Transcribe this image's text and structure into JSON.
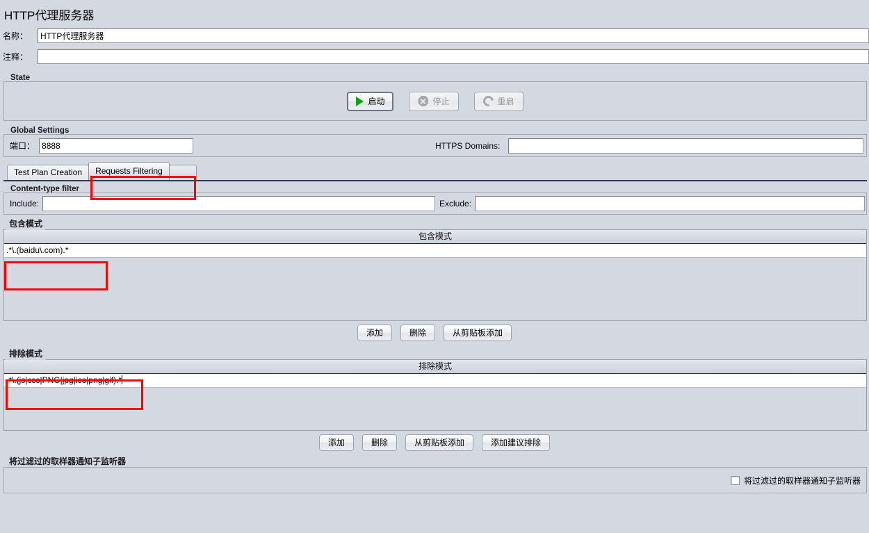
{
  "window": {
    "title": "HTTP代理服务器"
  },
  "header": {
    "name_label": "名称：",
    "name_value": "HTTP代理服务器",
    "comment_label": "注释：",
    "comment_value": ""
  },
  "state": {
    "group_title": "State",
    "buttons": [
      {
        "label": "启动",
        "icon": "play-icon",
        "enabled": true
      },
      {
        "label": "停止",
        "icon": "stop-icon",
        "enabled": false
      },
      {
        "label": "重启",
        "icon": "restart-icon",
        "enabled": false
      }
    ]
  },
  "global_settings": {
    "group_title": "Global Settings",
    "port_label": "端口：",
    "port_value": "8888",
    "https_domains_label": "HTTPS Domains:",
    "https_domains_value": ""
  },
  "tabs": [
    {
      "label": "Test Plan Creation",
      "active": false
    },
    {
      "label": "Requests Filtering",
      "active": true
    }
  ],
  "content_type_filter": {
    "group_title": "Content-type filter",
    "include_label": "Include:",
    "include_value": "",
    "exclude_label": "Exclude:",
    "exclude_value": ""
  },
  "include_patterns": {
    "group_title": "包含模式",
    "column_header": "包含模式",
    "rows": [
      ".*\\.(baidu\\.com).*"
    ],
    "buttons": [
      "添加",
      "删除",
      "从剪贴板添加"
    ]
  },
  "exclude_patterns": {
    "group_title": "排除模式",
    "column_header": "排除模式",
    "rows": [
      ".*\\.(js|css|PNG|jpg|ico|png|gif).*"
    ],
    "buttons": [
      "添加",
      "删除",
      "从剪贴板添加",
      "添加建议排除"
    ]
  },
  "notify_listeners": {
    "group_title": "将过滤过的取样器通知子监听器",
    "checkbox_label": "将过滤过的取样器通知子监听器",
    "checked": false
  },
  "colors": {
    "background": "#d4d8e0",
    "field_background": "#ffffff",
    "annotation": "#ff0000",
    "accent_underline": "#2b3a55",
    "play_green": "#14a014"
  }
}
